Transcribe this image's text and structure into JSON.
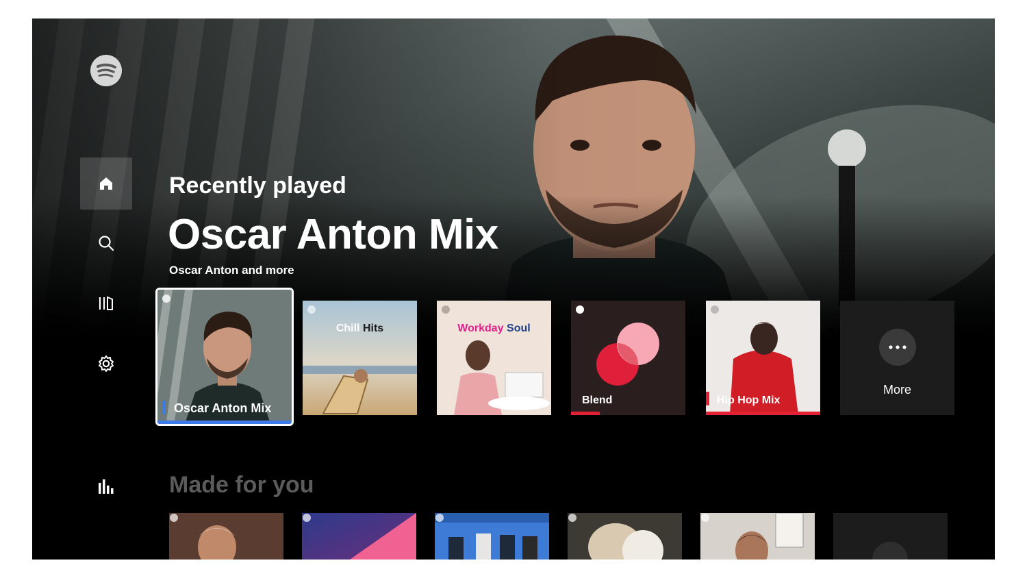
{
  "app": {
    "name": "Spotify",
    "brand_color": "#1DB954",
    "accent_blue": "#3d7ce6",
    "accent_red": "#e22134"
  },
  "sidebar": {
    "items": [
      {
        "id": "home",
        "icon": "home-icon",
        "active": true
      },
      {
        "id": "search",
        "icon": "search-icon",
        "active": false
      },
      {
        "id": "library",
        "icon": "library-icon",
        "active": false
      },
      {
        "id": "settings",
        "icon": "gear-icon",
        "active": false
      },
      {
        "id": "stats",
        "icon": "bar-chart-icon",
        "active": false
      }
    ]
  },
  "hero": {
    "eyebrow": "Recently played",
    "title": "Oscar Anton Mix",
    "subtitle": "Oscar Anton and more"
  },
  "recently_played": {
    "cards": [
      {
        "label": "Oscar Anton Mix",
        "selected": true,
        "progress": 1.0,
        "accent": "#3d7ce6"
      },
      {
        "title_a": "Chill",
        "title_b": "Hits"
      },
      {
        "title_a": "Workday",
        "title_b": "Soul"
      },
      {
        "label": "Blend",
        "progress": 0.25,
        "accent": "#e22134"
      },
      {
        "label": "Hip Hop Mix",
        "progress": 1.0,
        "accent": "#e22134"
      }
    ],
    "more_label": "More"
  },
  "made_for_you": {
    "title": "Made for you"
  }
}
